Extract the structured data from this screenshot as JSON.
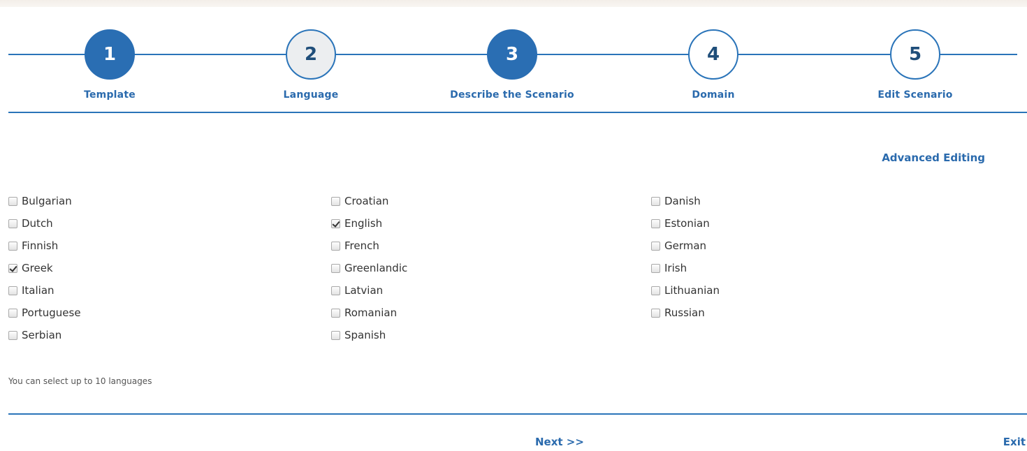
{
  "wizard": {
    "steps": [
      {
        "number": "1",
        "label": "Template",
        "state": "active"
      },
      {
        "number": "2",
        "label": "Language",
        "state": "current"
      },
      {
        "number": "3",
        "label": "Describe the Scenario",
        "state": "active"
      },
      {
        "number": "4",
        "label": "Domain",
        "state": "pending"
      },
      {
        "number": "5",
        "label": "Edit Scenario",
        "state": "pending"
      }
    ],
    "colors": {
      "accent": "#2a6eb3",
      "line": "#2a74b9",
      "current_fill": "#eceef0"
    }
  },
  "advanced_editing_label": "Advanced Editing",
  "languages": {
    "columns": [
      [
        {
          "label": "Bulgarian",
          "checked": false
        },
        {
          "label": "Dutch",
          "checked": false
        },
        {
          "label": "Finnish",
          "checked": false
        },
        {
          "label": "Greek",
          "checked": true
        },
        {
          "label": "Italian",
          "checked": false
        },
        {
          "label": "Portuguese",
          "checked": false
        },
        {
          "label": "Serbian",
          "checked": false
        }
      ],
      [
        {
          "label": "Croatian",
          "checked": false
        },
        {
          "label": "English",
          "checked": true
        },
        {
          "label": "French",
          "checked": false
        },
        {
          "label": "Greenlandic",
          "checked": false
        },
        {
          "label": "Latvian",
          "checked": false
        },
        {
          "label": "Romanian",
          "checked": false
        },
        {
          "label": "Spanish",
          "checked": false
        }
      ],
      [
        {
          "label": "Danish",
          "checked": false
        },
        {
          "label": "Estonian",
          "checked": false
        },
        {
          "label": "German",
          "checked": false
        },
        {
          "label": "Irish",
          "checked": false
        },
        {
          "label": "Lithuanian",
          "checked": false
        },
        {
          "label": "Russian",
          "checked": false
        }
      ]
    ]
  },
  "hint_text": "You can select up to 10 languages",
  "footer": {
    "next_label": "Next >>",
    "exit_label": "Exit"
  }
}
